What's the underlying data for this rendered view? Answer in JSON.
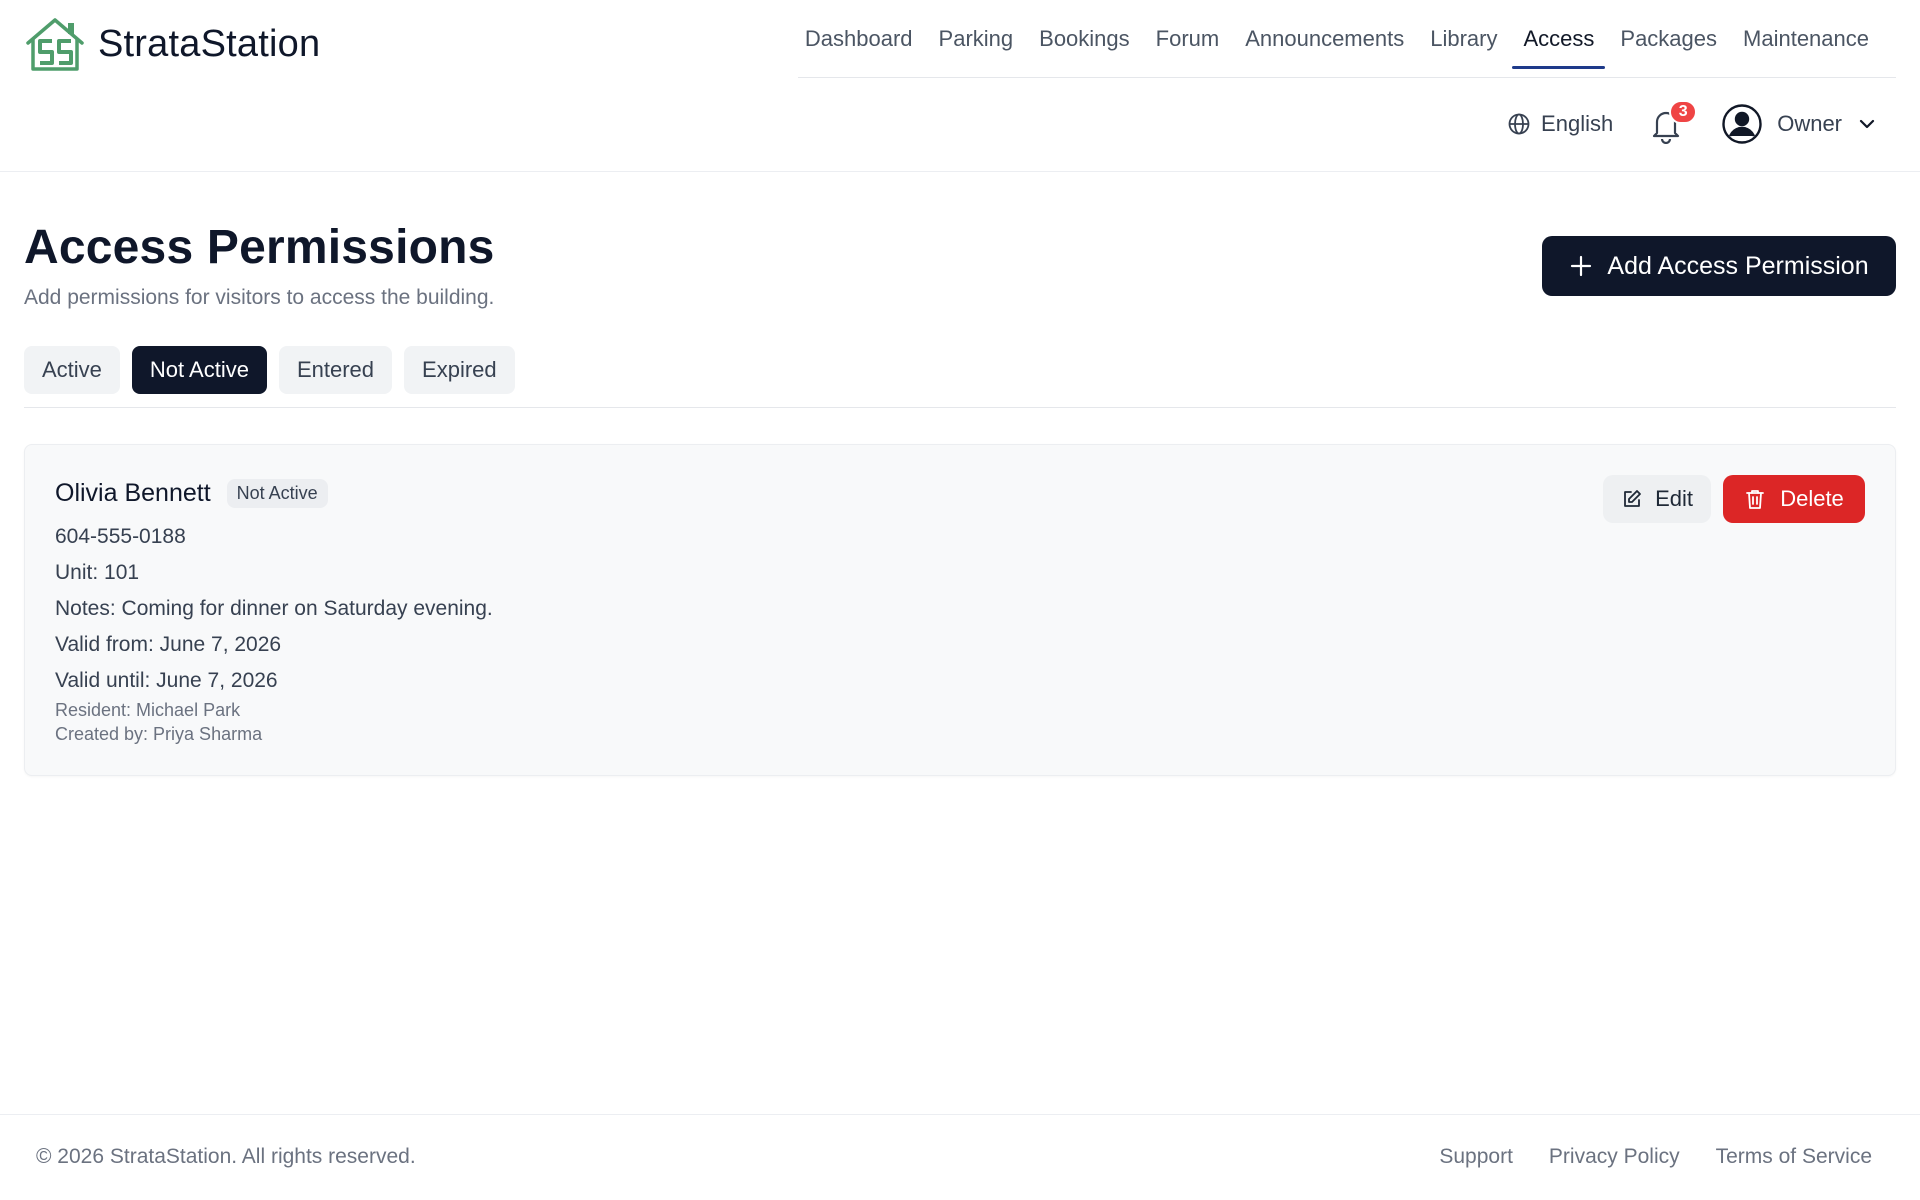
{
  "app": {
    "name": "StrataStation"
  },
  "nav": {
    "items": [
      {
        "label": "Dashboard"
      },
      {
        "label": "Parking"
      },
      {
        "label": "Bookings"
      },
      {
        "label": "Forum"
      },
      {
        "label": "Announcements"
      },
      {
        "label": "Library"
      },
      {
        "label": "Access",
        "active": true
      },
      {
        "label": "Packages"
      },
      {
        "label": "Maintenance"
      }
    ]
  },
  "utility": {
    "language": "English",
    "notification_count": "3",
    "user_role": "Owner"
  },
  "page": {
    "title": "Access Permissions",
    "subtitle": "Add permissions for visitors to access the building.",
    "add_button_label": "Add Access Permission"
  },
  "tabs": [
    {
      "label": "Active"
    },
    {
      "label": "Not Active",
      "active": true
    },
    {
      "label": "Entered"
    },
    {
      "label": "Expired"
    }
  ],
  "permission": {
    "name": "Olivia Bennett",
    "status": "Not Active",
    "phone": "604-555-0188",
    "unit": "Unit: 101",
    "notes": "Notes: Coming for dinner on Saturday evening.",
    "valid_from": "Valid from: June 7, 2026",
    "valid_until": "Valid until: June 7, 2026",
    "resident": "Resident: Michael Park",
    "created_by": "Created by: Priya Sharma",
    "edit_label": "Edit",
    "delete_label": "Delete"
  },
  "footer": {
    "copyright": "© 2026 StrataStation. All rights reserved.",
    "links": [
      {
        "label": "Support"
      },
      {
        "label": "Privacy Policy"
      },
      {
        "label": "Terms of Service"
      }
    ]
  },
  "colors": {
    "primary_dark": "#0f172a",
    "danger": "#dc2626",
    "badge_red": "#ef4444",
    "nav_active_underline": "#1e3a8a",
    "logo_green": "#4f9d6b"
  }
}
